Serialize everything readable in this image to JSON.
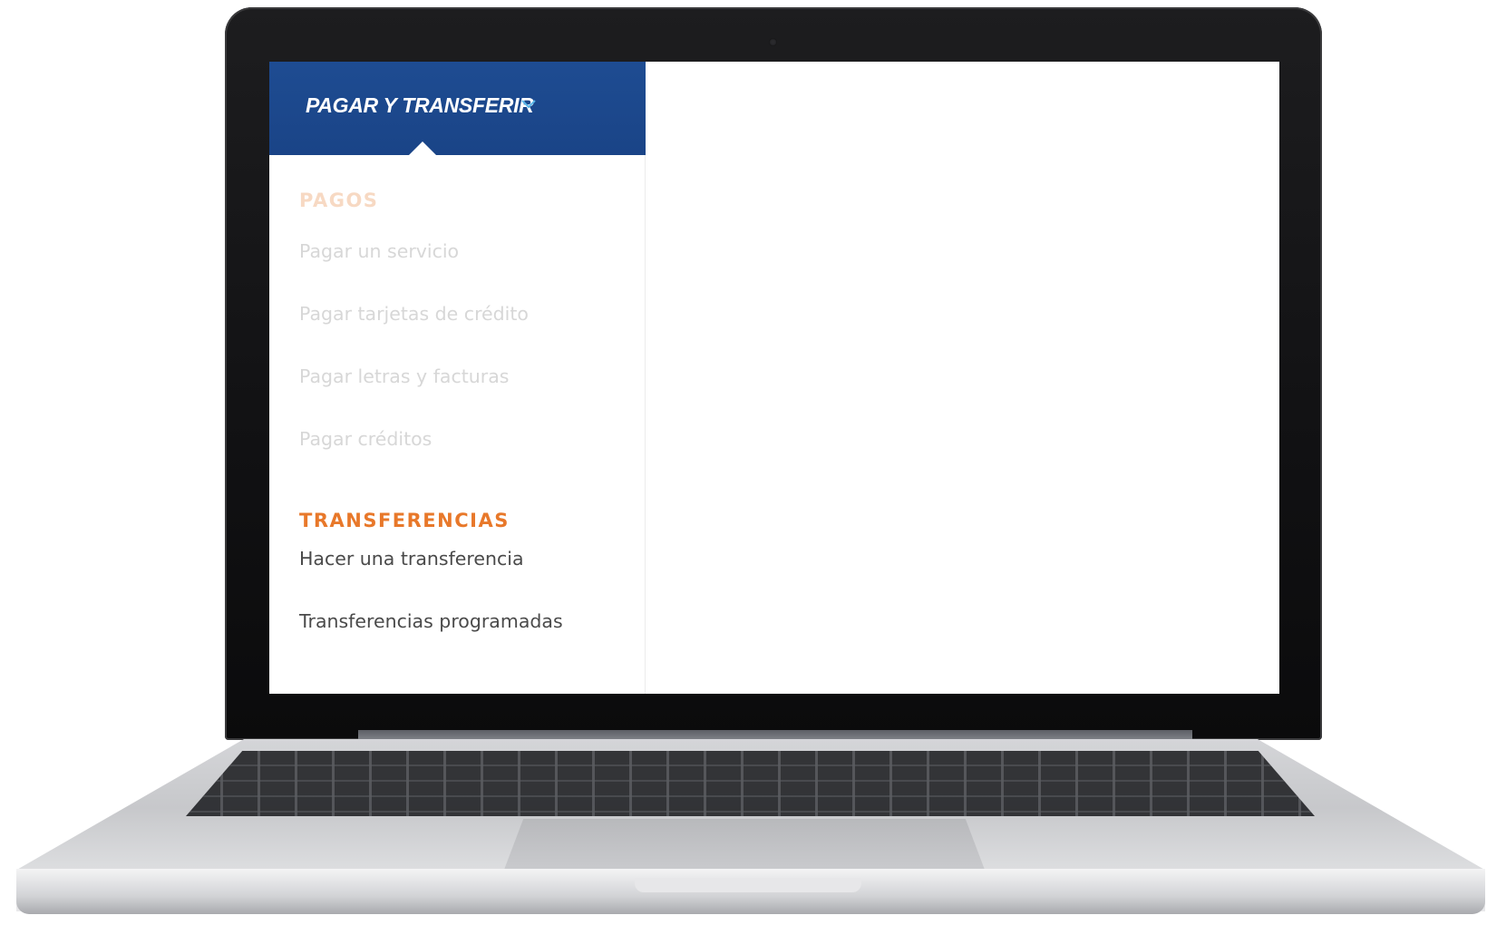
{
  "menu": {
    "header_title": "PAGAR Y TRANSFERIR",
    "header_icon": "chevron-down-icon",
    "sections": [
      {
        "title": "PAGOS",
        "items": [
          "Pagar un servicio",
          "Pagar tarjetas de crédito",
          "Pagar letras y facturas",
          "Pagar créditos"
        ]
      },
      {
        "title": "TRANSFERENCIAS",
        "items": [
          "Hacer una transferencia",
          "Transferencias programadas"
        ]
      }
    ]
  },
  "colors": {
    "header_blue": "#1e4c92",
    "accent_orange": "#e8782a",
    "chevron_blue": "#59b7ea"
  }
}
